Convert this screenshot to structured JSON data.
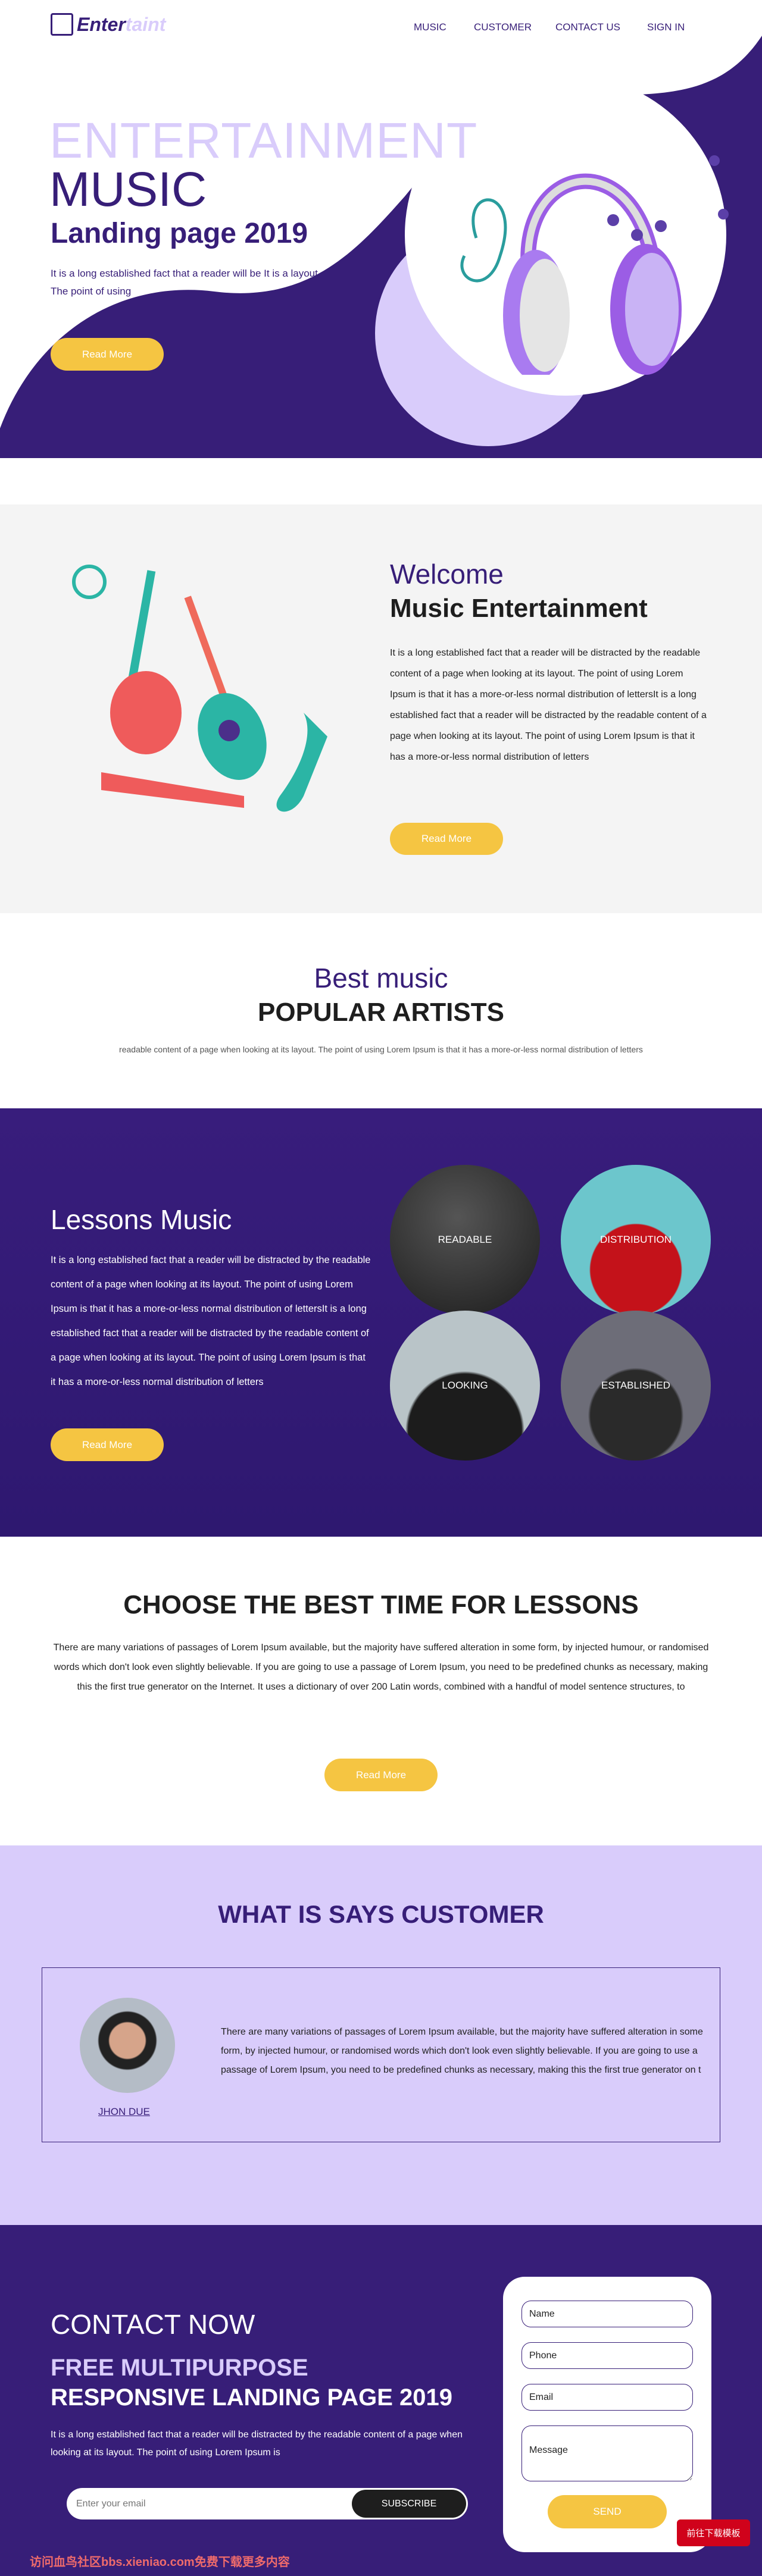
{
  "colors": {
    "primary": "#371e78",
    "lavender": "#d9ccfb",
    "accent": "#f5c542",
    "gray": "#f4f4f4"
  },
  "header": {
    "logo_a": "Enter",
    "logo_b": "taint",
    "logo_icon": "clapperboard-icon",
    "nav": [
      "MUSIC",
      "CUSTOMER",
      "CONTACT US",
      "SIGN IN"
    ]
  },
  "hero": {
    "title1": "ENTERTAINMENT",
    "title2": "MUSIC",
    "title3": "Landing page 2019",
    "text1": "It is a long established fact that a reader will be It is a layout.",
    "text2": "The point of using",
    "button": "Read More"
  },
  "welcome": {
    "kicker": "Welcome",
    "title": "Music Entertainment",
    "text": "It is a long established fact that a reader will be distracted by the readable content of a page when looking at its layout. The point of using Lorem Ipsum is that it has a more-or-less normal distribution of lettersIt is a long established fact that a reader will be distracted by the readable content of a page when looking at its layout. The point of using Lorem Ipsum is that it has a more-or-less normal distribution of letters",
    "button": "Read More"
  },
  "artists": {
    "kicker": "Best music",
    "title": "POPULAR ARTISTS",
    "text": "readable content of a page when looking at its layout. The point of using Lorem Ipsum is that it has a more-or-less normal distribution of letters"
  },
  "lessons": {
    "title": "Lessons Music",
    "text": "It is a long established fact that a reader will be distracted by the readable content of a page when looking at its layout. The point of using Lorem Ipsum is that it has a more-or-less normal distribution of lettersIt is a long established fact that a reader will be distracted by the readable content of a page when looking at its layout. The point of using Lorem Ipsum is that it has a more-or-less normal distribution of letters",
    "button": "Read More",
    "artists": [
      "READABLE",
      "DISTRIBUTION",
      "LOOKING",
      "ESTABLISHED"
    ]
  },
  "choose": {
    "title": "CHOOSE THE BEST TIME FOR LESSONS",
    "text": "There are many variations of passages of Lorem Ipsum available, but the majority have suffered alteration in some form, by injected humour, or randomised words which don't look even slightly believable. If you are going to use a passage of Lorem Ipsum, you need to be predefined chunks as necessary, making this the first true generator on the Internet. It uses a dictionary of over 200 Latin words, combined with a handful of model sentence structures, to",
    "button": "Read More"
  },
  "customer": {
    "title": "WHAT IS SAYS CUSTOMER",
    "name": "JHON DUE",
    "text": "There are many variations of passages of Lorem Ipsum available, but the majority have suffered alteration in some form, by injected humour, or randomised words which don't look even slightly believable. If you are going to use a passage of Lorem Ipsum, you need to be predefined chunks as necessary, making this the first true generator on t"
  },
  "contact": {
    "title": "CONTACT NOW",
    "sub1": "FREE MULTIPURPOSE",
    "sub2": "RESPONSIVE LANDING PAGE 2019",
    "text": "It is a long established fact that a reader will be distracted by the readable content of a page when looking at its layout. The point of using Lorem Ipsum is",
    "email_placeholder": "Enter your email",
    "subscribe": "SUBSCRIBE",
    "form": {
      "name": "Name",
      "phone": "Phone",
      "email": "Email",
      "message": "Message",
      "send": "SEND"
    }
  },
  "badge": "前往下载模板",
  "watermark": "访问血鸟社区bbs.xieniao.com免费下载更多内容"
}
